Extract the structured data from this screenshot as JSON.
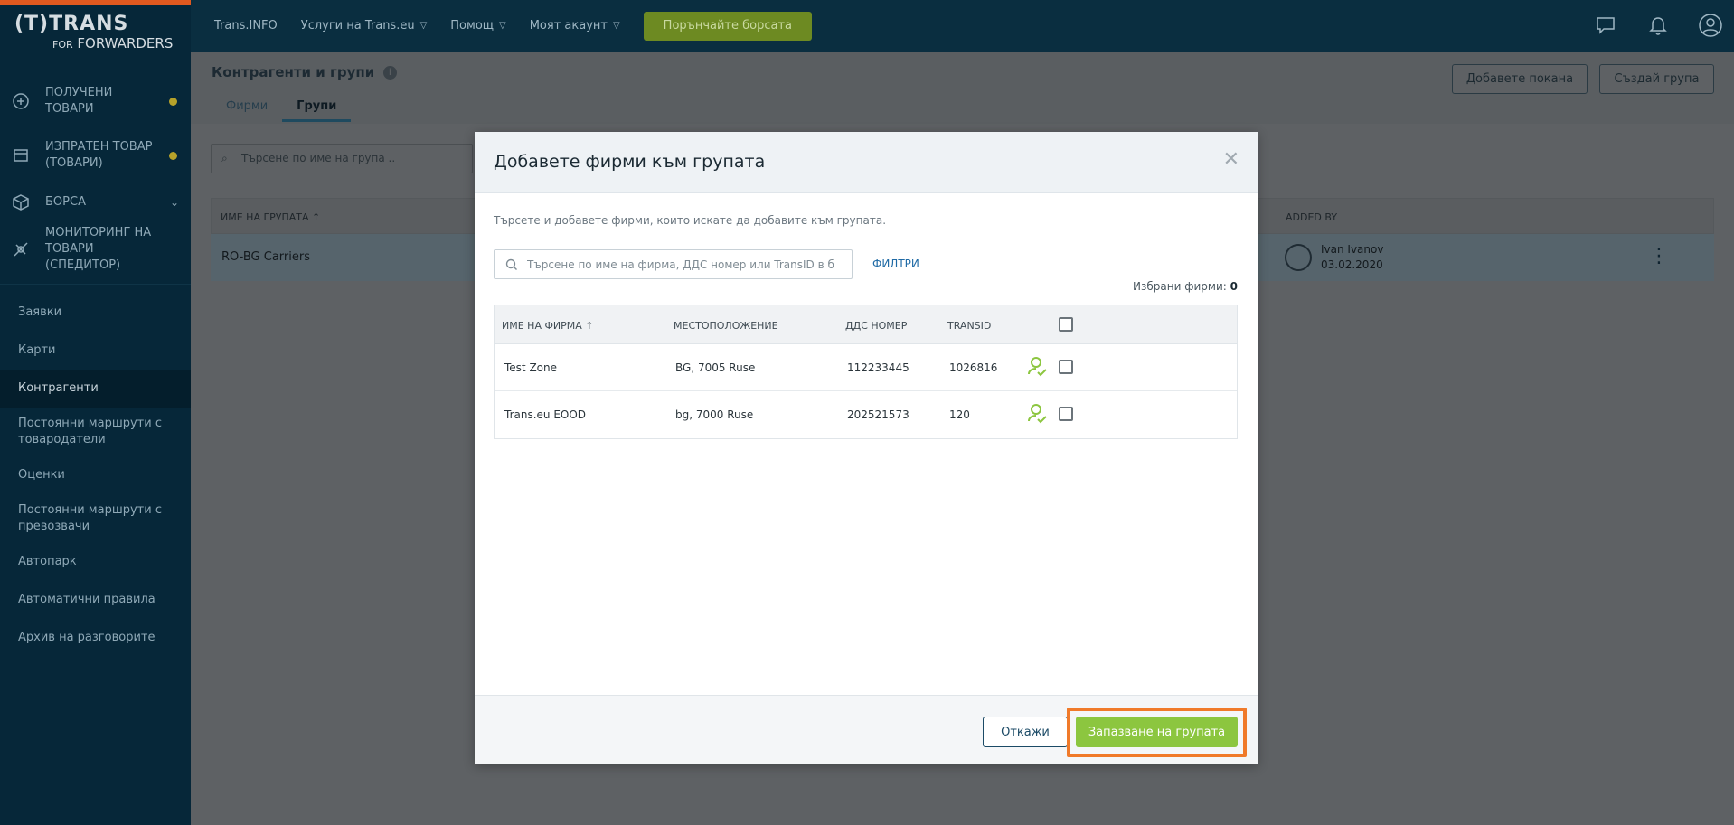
{
  "logo": {
    "line1": "(T)TRANS",
    "for": "FOR",
    "line2": "FORWARDERS"
  },
  "sidebar": {
    "main_items": [
      {
        "label": "ПОЛУЧЕНИ ТОВАРИ"
      },
      {
        "label": "ИЗПРАТЕН ТОВАР (ТОВАРИ)"
      },
      {
        "label": "БОРСА"
      },
      {
        "label": "МОНИТОРИНГ НА ТОВАРИ (СПЕДИТОР)"
      }
    ],
    "links": [
      {
        "label": "Заявки"
      },
      {
        "label": "Карти"
      },
      {
        "label": "Контрагенти"
      },
      {
        "label": "Постоянни маршрути с товародатели"
      },
      {
        "label": "Оценки"
      },
      {
        "label": "Постоянни маршрути с превозвачи"
      },
      {
        "label": "Автопарк"
      },
      {
        "label": "Автоматични правила"
      },
      {
        "label": "Архив на разговорите"
      }
    ],
    "active_link": "Контрагенти",
    "dot_color": "#b6a22a"
  },
  "topbar": {
    "nav": [
      "Trans.INFO",
      "Услуги на Trans.eu",
      "Помощ",
      "Моят акаунт"
    ],
    "cta": "Порънчайте борсата"
  },
  "page": {
    "title": "Контрагенти и групи",
    "tabs": [
      "Фирми",
      "Групи"
    ],
    "active_tab": "Групи",
    "btn_invite": "Добавете покана",
    "btn_create_group": "Създай група",
    "search_placeholder": "Търсене по име на група ..",
    "table": {
      "col_name": "ИМЕ НА ГРУПАТА ↑",
      "col_added_by": "ADDED BY",
      "row_name": "RO-BG Carriers",
      "row_user": "Ivan Ivanov",
      "row_date": "03.02.2020"
    }
  },
  "modal": {
    "title": "Добавете фирми към групата",
    "description": "Търсете и добавете фирми, които искате да добавите към групата.",
    "search_placeholder": "Търсене по име на фирма, ДДС номер или TransID в б...",
    "filters": "ФИЛТРИ",
    "selected_label": "Избрани фирми:",
    "selected_count": "0",
    "columns": [
      "ИМЕ НА ФИРМА ↑",
      "МЕСТОПОЛОЖЕНИЕ",
      "ДДС НОМЕР",
      "TRANSID"
    ],
    "rows": [
      {
        "name": "Test Zone",
        "location": "BG, 7005 Ruse",
        "vat": "112233445",
        "transid": "1026816"
      },
      {
        "name": "Trans.eu EOOD",
        "location": "bg, 7000 Ruse",
        "vat": "202521573",
        "transid": "120"
      }
    ],
    "btn_cancel": "Откажи",
    "btn_save": "Запазване на групата",
    "accent_green": "#8cc63f",
    "highlight_color": "#f07a2a"
  }
}
